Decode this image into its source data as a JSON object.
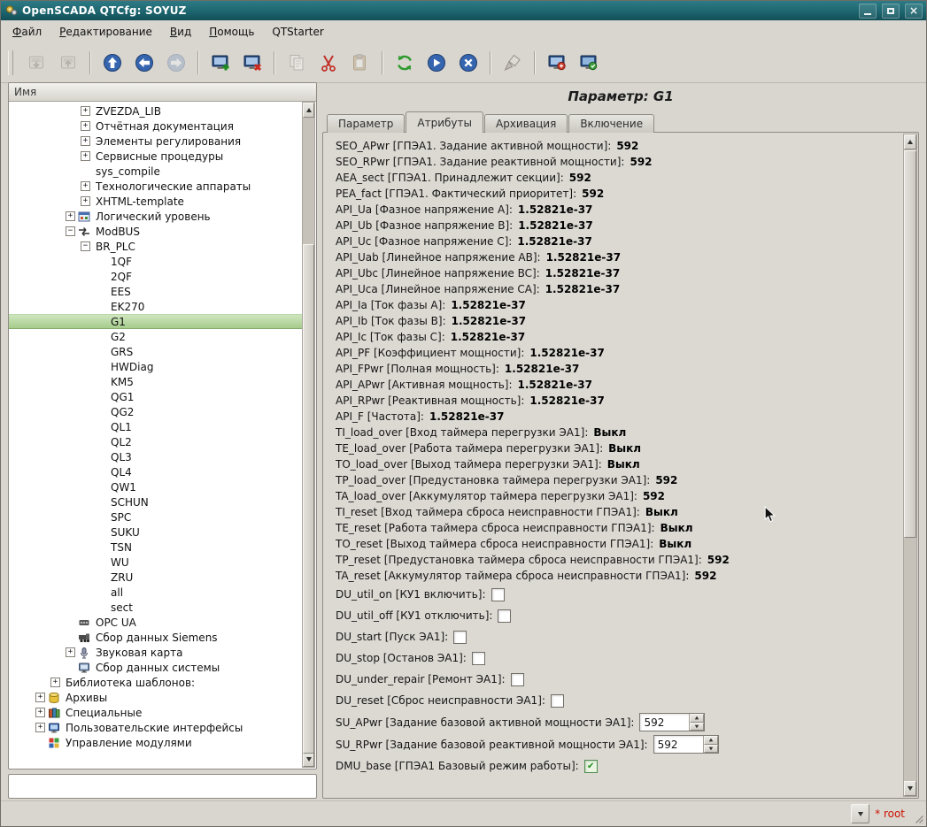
{
  "window": {
    "title": "OpenSCADA QTCfg: SOYUZ"
  },
  "menubar": {
    "items": [
      {
        "name": "file",
        "label": "Файл",
        "underline_first": true
      },
      {
        "name": "edit",
        "label": "Редактирование",
        "underline_first": true
      },
      {
        "name": "view",
        "label": "Вид",
        "underline_first": true
      },
      {
        "name": "help",
        "label": "Помощь",
        "underline_first": true
      },
      {
        "name": "qtstarter",
        "label": "QTStarter",
        "underline_first": false
      }
    ]
  },
  "toolbar": {
    "buttons": [
      {
        "name": "load-from-db-button",
        "icon": "load-icon",
        "disabled": true
      },
      {
        "name": "save-to-db-button",
        "icon": "save-icon",
        "disabled": true
      },
      {
        "separator": true
      },
      {
        "name": "up-level-button",
        "icon": "up-icon"
      },
      {
        "name": "back-button",
        "icon": "back-icon"
      },
      {
        "name": "forward-button",
        "icon": "forward-icon",
        "disabled": true
      },
      {
        "separator": true
      },
      {
        "name": "add-item-button",
        "icon": "add-item-icon"
      },
      {
        "name": "delete-item-button",
        "icon": "delete-item-icon"
      },
      {
        "separator": true
      },
      {
        "name": "copy-item-button",
        "icon": "copy-icon",
        "disabled": true
      },
      {
        "name": "cut-item-button",
        "icon": "cut-icon"
      },
      {
        "name": "paste-item-button",
        "icon": "paste-icon",
        "disabled": true
      },
      {
        "separator": true
      },
      {
        "name": "refresh-button",
        "icon": "refresh-icon"
      },
      {
        "name": "start-updating-button",
        "icon": "start-icon"
      },
      {
        "name": "stop-updating-button",
        "icon": "stop-icon"
      },
      {
        "separator": true
      },
      {
        "name": "clear-changes-button",
        "icon": "clean-icon"
      },
      {
        "separator": true
      },
      {
        "name": "qtcfg-window-button",
        "icon": "qtcfg-window-icon"
      },
      {
        "name": "vision-window-button",
        "icon": "vision-window-icon"
      }
    ]
  },
  "tree": {
    "header": "Имя",
    "items": [
      {
        "label": "ZVEZDA_LIB",
        "indent": 4,
        "expander": "plus"
      },
      {
        "label": "Отчётная документация",
        "name": "report-docs",
        "indent": 4,
        "expander": "plus"
      },
      {
        "label": "Элементы регулирования",
        "name": "regulation-elements",
        "indent": 4,
        "expander": "plus"
      },
      {
        "label": "Сервисные процедуры",
        "name": "service-procedures",
        "indent": 4,
        "expander": "plus"
      },
      {
        "label": "sys_compile",
        "indent": 4
      },
      {
        "label": "Технологические аппараты",
        "name": "tech-devices",
        "indent": 4,
        "expander": "plus"
      },
      {
        "label": "XHTML-template",
        "indent": 4,
        "expander": "plus"
      },
      {
        "label": "Логический уровень",
        "name": "logic-level",
        "indent": 3,
        "expander": "plus",
        "icon": "logic-level-icon"
      },
      {
        "label": "ModBUS",
        "indent": 3,
        "expander": "minus",
        "icon": "modbus-icon"
      },
      {
        "label": "BR_PLC",
        "indent": 4,
        "expander": "minus"
      },
      {
        "label": "1QF",
        "indent": 5
      },
      {
        "label": "2QF",
        "indent": 5
      },
      {
        "label": "EES",
        "indent": 5
      },
      {
        "label": "EK270",
        "indent": 5
      },
      {
        "label": "G1",
        "indent": 5,
        "selected": true
      },
      {
        "label": "G2",
        "indent": 5
      },
      {
        "label": "GRS",
        "indent": 5
      },
      {
        "label": "HWDiag",
        "indent": 5
      },
      {
        "label": "KM5",
        "indent": 5
      },
      {
        "label": "QG1",
        "indent": 5
      },
      {
        "label": "QG2",
        "indent": 5
      },
      {
        "label": "QL1",
        "indent": 5
      },
      {
        "label": "QL2",
        "indent": 5
      },
      {
        "label": "QL3",
        "indent": 5
      },
      {
        "label": "QL4",
        "indent": 5
      },
      {
        "label": "QW1",
        "indent": 5
      },
      {
        "label": "SCHUN",
        "indent": 5
      },
      {
        "label": "SPC",
        "indent": 5
      },
      {
        "label": "SUKU",
        "indent": 5
      },
      {
        "label": "TSN",
        "indent": 5
      },
      {
        "label": "WU",
        "indent": 5
      },
      {
        "label": "ZRU",
        "indent": 5
      },
      {
        "label": "all",
        "indent": 5
      },
      {
        "label": "sect",
        "indent": 5
      },
      {
        "label": "OPC UA",
        "name": "opc-ua",
        "indent": 3,
        "icon": "opcua-icon"
      },
      {
        "label": "Сбор данных Siemens",
        "name": "siemens-daq",
        "indent": 3,
        "icon": "siemens-icon"
      },
      {
        "label": "Звуковая карта",
        "name": "sound-card",
        "indent": 3,
        "expander": "plus",
        "icon": "soundcard-icon"
      },
      {
        "label": "Сбор данных системы",
        "name": "system-daq",
        "indent": 3,
        "icon": "system-daq-icon"
      },
      {
        "label": "Библиотека шаблонов:",
        "name": "template-libs",
        "indent": 2,
        "expander": "plus"
      },
      {
        "label": "Архивы",
        "name": "archives",
        "indent": 1,
        "expander": "plus",
        "icon": "archives-icon"
      },
      {
        "label": "Специальные",
        "name": "special",
        "indent": 1,
        "expander": "plus",
        "icon": "special-icon"
      },
      {
        "label": "Пользовательские интерфейсы",
        "name": "user-interfaces",
        "indent": 1,
        "expander": "plus",
        "icon": "ui-icon"
      },
      {
        "label": "Управление модулями",
        "name": "modules-management",
        "indent": 1,
        "icon": "modules-icon"
      }
    ]
  },
  "filter_input": {
    "value": "",
    "placeholder": ""
  },
  "params_panel": {
    "title": "Параметр: G1",
    "tabs": [
      {
        "name": "param",
        "label": "Параметр"
      },
      {
        "name": "attributes",
        "label": "Атрибуты",
        "active": true
      },
      {
        "name": "archiving",
        "label": "Архивация"
      },
      {
        "name": "enable",
        "label": "Включение"
      }
    ],
    "attributes": [
      {
        "id": "SEO_APwr",
        "label": "SEO_APwr [ГПЭА1. Задание активной мощности]:",
        "value": "592"
      },
      {
        "id": "SEO_RPwr",
        "label": "SEO_RPwr [ГПЭА1. Задание реактивной мощности]:",
        "value": "592"
      },
      {
        "id": "AEA_sect",
        "label": "AEA_sect [ГПЭА1. Принадлежит секции]:",
        "value": "592"
      },
      {
        "id": "PEA_fact",
        "label": "PEA_fact [ГПЭА1. Фактический приоритет]:",
        "value": "592"
      },
      {
        "id": "API_Ua",
        "label": "API_Ua [Фазное напряжение A]:",
        "value": "1.52821e-37"
      },
      {
        "id": "API_Ub",
        "label": "API_Ub [Фазное напряжение B]:",
        "value": "1.52821e-37"
      },
      {
        "id": "API_Uc",
        "label": "API_Uc [Фазное напряжение C]:",
        "value": "1.52821e-37"
      },
      {
        "id": "API_Uab",
        "label": "API_Uab [Линейное напряжение AB]:",
        "value": "1.52821e-37"
      },
      {
        "id": "API_Ubc",
        "label": "API_Ubc [Линейное напряжение BC]:",
        "value": "1.52821e-37"
      },
      {
        "id": "API_Uca",
        "label": "API_Uca [Линейное напряжение CA]:",
        "value": "1.52821e-37"
      },
      {
        "id": "API_Ia",
        "label": "API_Ia [Ток фазы A]:",
        "value": "1.52821e-37"
      },
      {
        "id": "API_Ib",
        "label": "API_Ib [Ток фазы B]:",
        "value": "1.52821e-37"
      },
      {
        "id": "API_Ic",
        "label": "API_Ic [Ток фазы C]:",
        "value": "1.52821e-37"
      },
      {
        "id": "API_PF",
        "label": "API_PF [Коэффициент мощности]:",
        "value": "1.52821e-37"
      },
      {
        "id": "API_FPwr",
        "label": "API_FPwr [Полная мощность]:",
        "value": "1.52821e-37"
      },
      {
        "id": "API_APwr",
        "label": "API_APwr [Активная мощность]:",
        "value": "1.52821e-37"
      },
      {
        "id": "API_RPwr",
        "label": "API_RPwr [Реактивная мощность]:",
        "value": "1.52821e-37"
      },
      {
        "id": "API_F",
        "label": "API_F [Частота]:",
        "value": "1.52821e-37"
      },
      {
        "id": "TI_load_over",
        "label": "TI_load_over [Вход таймера перегрузки ЭА1]:",
        "value": "Выкл"
      },
      {
        "id": "TE_load_over",
        "label": "TE_load_over [Работа таймера перегрузки ЭА1]:",
        "value": "Выкл"
      },
      {
        "id": "TO_load_over",
        "label": "TO_load_over [Выход таймера перегрузки ЭА1]:",
        "value": "Выкл"
      },
      {
        "id": "TP_load_over",
        "label": "TP_load_over [Предустановка таймера перегрузки ЭА1]:",
        "value": "592"
      },
      {
        "id": "TA_load_over",
        "label": "TA_load_over [Аккумулятор таймера перегрузки ЭА1]:",
        "value": "592"
      },
      {
        "id": "TI_reset",
        "label": "TI_reset [Вход таймера сброса неисправности ГПЭА1]:",
        "value": "Выкл"
      },
      {
        "id": "TE_reset",
        "label": "TE_reset [Работа таймера сброса неисправности ГПЭА1]:",
        "value": "Выкл"
      },
      {
        "id": "TO_reset",
        "label": "TO_reset [Выход таймера сброса неисправности ГПЭА1]:",
        "value": "Выкл"
      },
      {
        "id": "TP_reset",
        "label": "TP_reset [Предустановка таймера сброса неисправности ГПЭА1]:",
        "value": "592"
      },
      {
        "id": "TA_reset",
        "label": "TA_reset [Аккумулятор таймера сброса неисправности ГПЭА1]:",
        "value": "592"
      },
      {
        "id": "DU_util_on",
        "label": "DU_util_on [КУ1 включить]:",
        "control": "checkbox",
        "checked": false
      },
      {
        "id": "DU_util_off",
        "label": "DU_util_off [КУ1 отключить]:",
        "control": "checkbox",
        "checked": false
      },
      {
        "id": "DU_start",
        "label": "DU_start [Пуск ЭА1]:",
        "control": "checkbox",
        "checked": false
      },
      {
        "id": "DU_stop",
        "label": "DU_stop [Останов ЭА1]:",
        "control": "checkbox",
        "checked": false
      },
      {
        "id": "DU_under_repair",
        "label": "DU_under_repair [Ремонт ЭА1]:",
        "control": "checkbox",
        "checked": false
      },
      {
        "id": "DU_reset",
        "label": "DU_reset [Сброс неисправности ЭА1]:",
        "control": "checkbox",
        "checked": false
      },
      {
        "id": "SU_APwr",
        "label": "SU_APwr [Задание базовой активной мощности ЭА1]:",
        "control": "spinbox",
        "value": "592"
      },
      {
        "id": "SU_RPwr",
        "label": "SU_RPwr [Задание базовой реактивной мощности ЭА1]:",
        "control": "spinbox",
        "value": "592"
      },
      {
        "id": "DMU_base",
        "label": "DMU_base [ГПЭА1 Базовый режим работы]:",
        "control": "checkbox",
        "checked": true
      }
    ]
  },
  "statusbar": {
    "user": "* root",
    "user_color": "#cc1100"
  }
}
